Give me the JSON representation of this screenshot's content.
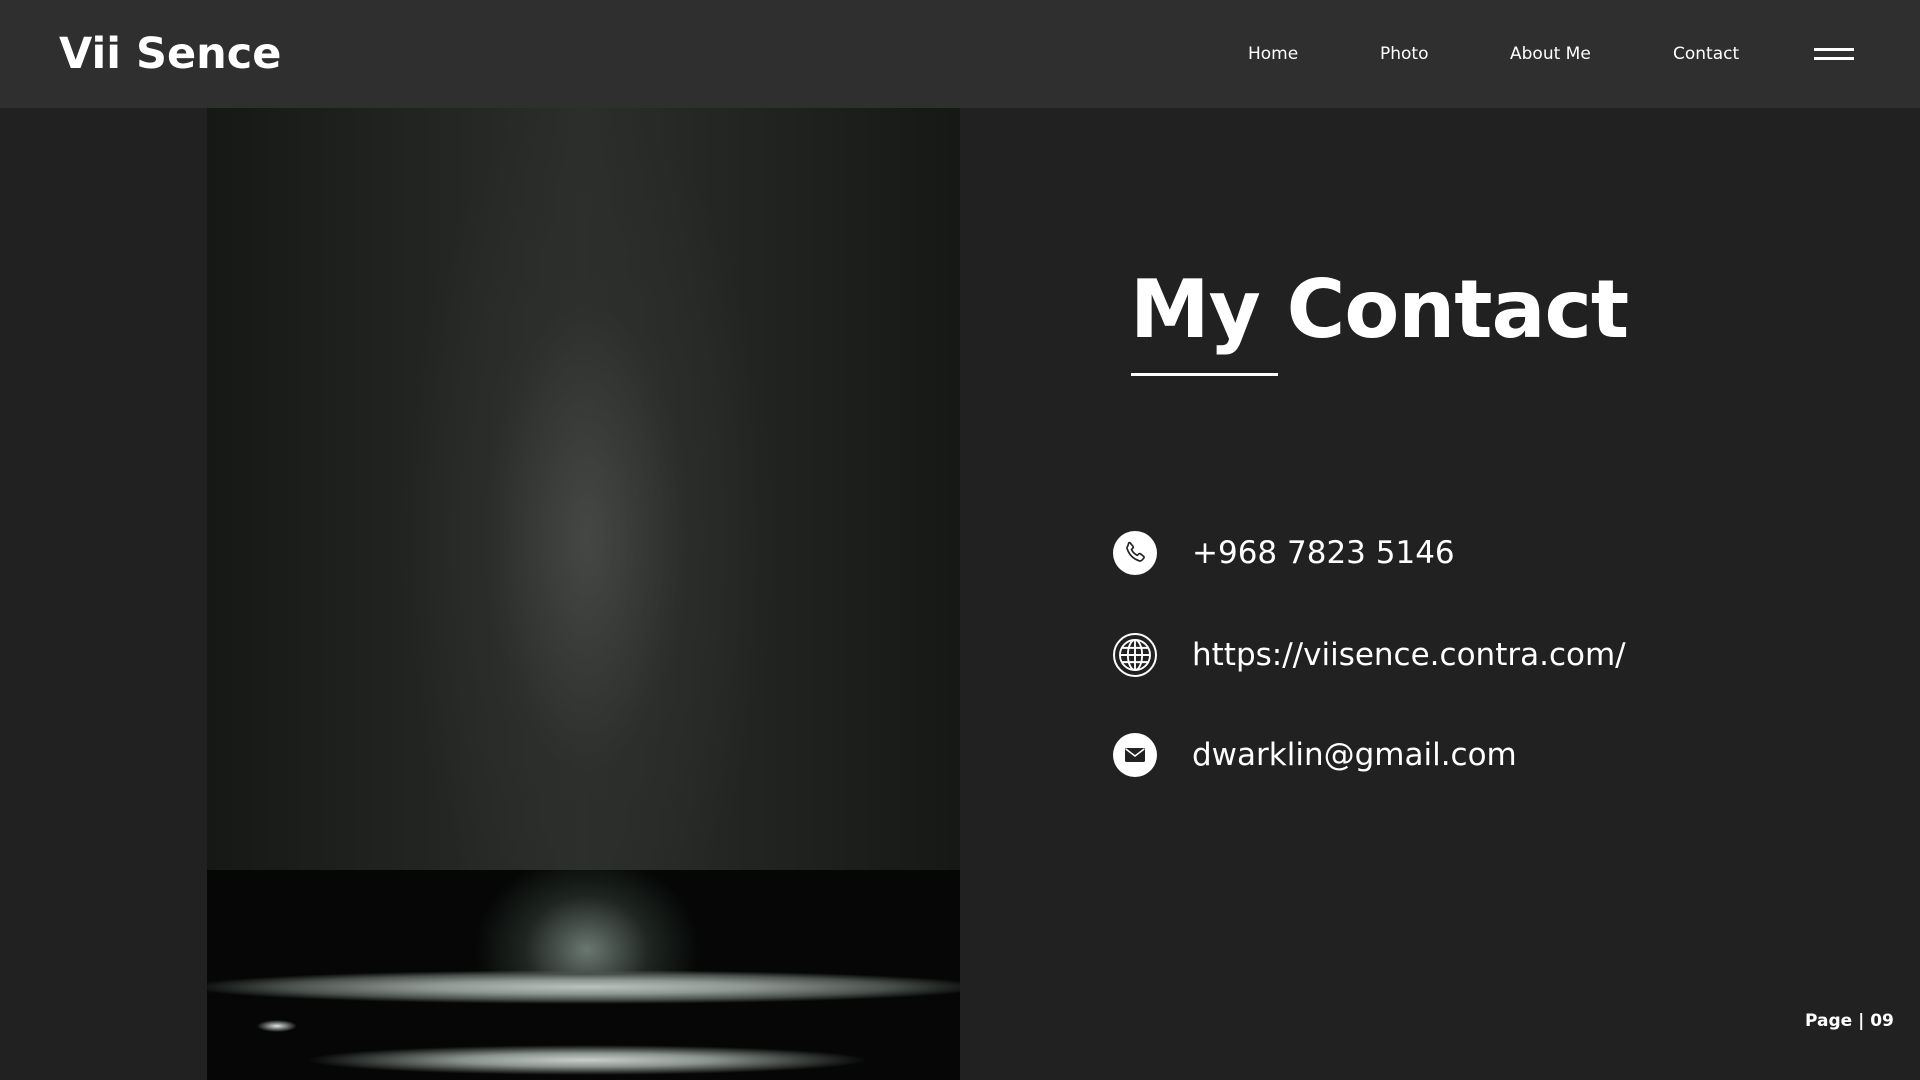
{
  "header": {
    "logo": "Vii Sence",
    "nav": [
      "Home",
      "Photo",
      "About Me",
      "Contact"
    ]
  },
  "main": {
    "heading": "My Contact",
    "contacts": [
      {
        "icon": "phone-icon",
        "text": "+968 7823 5146"
      },
      {
        "icon": "globe-icon",
        "text": "https://viisence.contra.com/"
      },
      {
        "icon": "mail-icon",
        "text": "dwarklin@gmail.com"
      }
    ]
  },
  "footer": {
    "page_label": "Page | 09"
  },
  "colors": {
    "background": "#212121",
    "topbar": "#2f2f2f",
    "text": "#ffffff"
  }
}
